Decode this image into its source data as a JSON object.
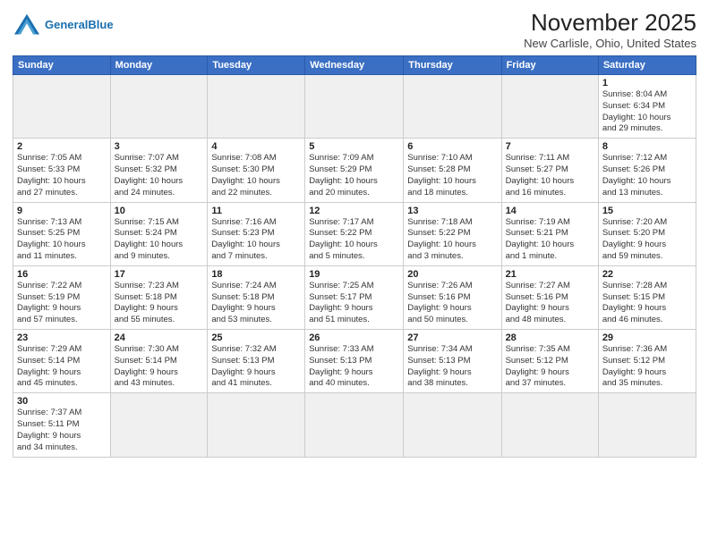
{
  "header": {
    "logo_general": "General",
    "logo_blue": "Blue",
    "month": "November 2025",
    "location": "New Carlisle, Ohio, United States"
  },
  "days_of_week": [
    "Sunday",
    "Monday",
    "Tuesday",
    "Wednesday",
    "Thursday",
    "Friday",
    "Saturday"
  ],
  "weeks": [
    [
      {
        "num": "",
        "info": "",
        "empty": true
      },
      {
        "num": "",
        "info": "",
        "empty": true
      },
      {
        "num": "",
        "info": "",
        "empty": true
      },
      {
        "num": "",
        "info": "",
        "empty": true
      },
      {
        "num": "",
        "info": "",
        "empty": true
      },
      {
        "num": "",
        "info": "",
        "empty": true
      },
      {
        "num": "1",
        "info": "Sunrise: 8:04 AM\nSunset: 6:34 PM\nDaylight: 10 hours\nand 29 minutes."
      }
    ],
    [
      {
        "num": "2",
        "info": "Sunrise: 7:05 AM\nSunset: 5:33 PM\nDaylight: 10 hours\nand 27 minutes."
      },
      {
        "num": "3",
        "info": "Sunrise: 7:07 AM\nSunset: 5:32 PM\nDaylight: 10 hours\nand 24 minutes."
      },
      {
        "num": "4",
        "info": "Sunrise: 7:08 AM\nSunset: 5:30 PM\nDaylight: 10 hours\nand 22 minutes."
      },
      {
        "num": "5",
        "info": "Sunrise: 7:09 AM\nSunset: 5:29 PM\nDaylight: 10 hours\nand 20 minutes."
      },
      {
        "num": "6",
        "info": "Sunrise: 7:10 AM\nSunset: 5:28 PM\nDaylight: 10 hours\nand 18 minutes."
      },
      {
        "num": "7",
        "info": "Sunrise: 7:11 AM\nSunset: 5:27 PM\nDaylight: 10 hours\nand 16 minutes."
      },
      {
        "num": "8",
        "info": "Sunrise: 7:12 AM\nSunset: 5:26 PM\nDaylight: 10 hours\nand 13 minutes."
      }
    ],
    [
      {
        "num": "9",
        "info": "Sunrise: 7:13 AM\nSunset: 5:25 PM\nDaylight: 10 hours\nand 11 minutes."
      },
      {
        "num": "10",
        "info": "Sunrise: 7:15 AM\nSunset: 5:24 PM\nDaylight: 10 hours\nand 9 minutes."
      },
      {
        "num": "11",
        "info": "Sunrise: 7:16 AM\nSunset: 5:23 PM\nDaylight: 10 hours\nand 7 minutes."
      },
      {
        "num": "12",
        "info": "Sunrise: 7:17 AM\nSunset: 5:22 PM\nDaylight: 10 hours\nand 5 minutes."
      },
      {
        "num": "13",
        "info": "Sunrise: 7:18 AM\nSunset: 5:22 PM\nDaylight: 10 hours\nand 3 minutes."
      },
      {
        "num": "14",
        "info": "Sunrise: 7:19 AM\nSunset: 5:21 PM\nDaylight: 10 hours\nand 1 minute."
      },
      {
        "num": "15",
        "info": "Sunrise: 7:20 AM\nSunset: 5:20 PM\nDaylight: 9 hours\nand 59 minutes."
      }
    ],
    [
      {
        "num": "16",
        "info": "Sunrise: 7:22 AM\nSunset: 5:19 PM\nDaylight: 9 hours\nand 57 minutes."
      },
      {
        "num": "17",
        "info": "Sunrise: 7:23 AM\nSunset: 5:18 PM\nDaylight: 9 hours\nand 55 minutes."
      },
      {
        "num": "18",
        "info": "Sunrise: 7:24 AM\nSunset: 5:18 PM\nDaylight: 9 hours\nand 53 minutes."
      },
      {
        "num": "19",
        "info": "Sunrise: 7:25 AM\nSunset: 5:17 PM\nDaylight: 9 hours\nand 51 minutes."
      },
      {
        "num": "20",
        "info": "Sunrise: 7:26 AM\nSunset: 5:16 PM\nDaylight: 9 hours\nand 50 minutes."
      },
      {
        "num": "21",
        "info": "Sunrise: 7:27 AM\nSunset: 5:16 PM\nDaylight: 9 hours\nand 48 minutes."
      },
      {
        "num": "22",
        "info": "Sunrise: 7:28 AM\nSunset: 5:15 PM\nDaylight: 9 hours\nand 46 minutes."
      }
    ],
    [
      {
        "num": "23",
        "info": "Sunrise: 7:29 AM\nSunset: 5:14 PM\nDaylight: 9 hours\nand 45 minutes."
      },
      {
        "num": "24",
        "info": "Sunrise: 7:30 AM\nSunset: 5:14 PM\nDaylight: 9 hours\nand 43 minutes."
      },
      {
        "num": "25",
        "info": "Sunrise: 7:32 AM\nSunset: 5:13 PM\nDaylight: 9 hours\nand 41 minutes."
      },
      {
        "num": "26",
        "info": "Sunrise: 7:33 AM\nSunset: 5:13 PM\nDaylight: 9 hours\nand 40 minutes."
      },
      {
        "num": "27",
        "info": "Sunrise: 7:34 AM\nSunset: 5:13 PM\nDaylight: 9 hours\nand 38 minutes."
      },
      {
        "num": "28",
        "info": "Sunrise: 7:35 AM\nSunset: 5:12 PM\nDaylight: 9 hours\nand 37 minutes."
      },
      {
        "num": "29",
        "info": "Sunrise: 7:36 AM\nSunset: 5:12 PM\nDaylight: 9 hours\nand 35 minutes."
      }
    ],
    [
      {
        "num": "30",
        "info": "Sunrise: 7:37 AM\nSunset: 5:11 PM\nDaylight: 9 hours\nand 34 minutes."
      },
      {
        "num": "",
        "info": "",
        "empty": true
      },
      {
        "num": "",
        "info": "",
        "empty": true
      },
      {
        "num": "",
        "info": "",
        "empty": true
      },
      {
        "num": "",
        "info": "",
        "empty": true
      },
      {
        "num": "",
        "info": "",
        "empty": true
      },
      {
        "num": "",
        "info": "",
        "empty": true
      }
    ]
  ]
}
